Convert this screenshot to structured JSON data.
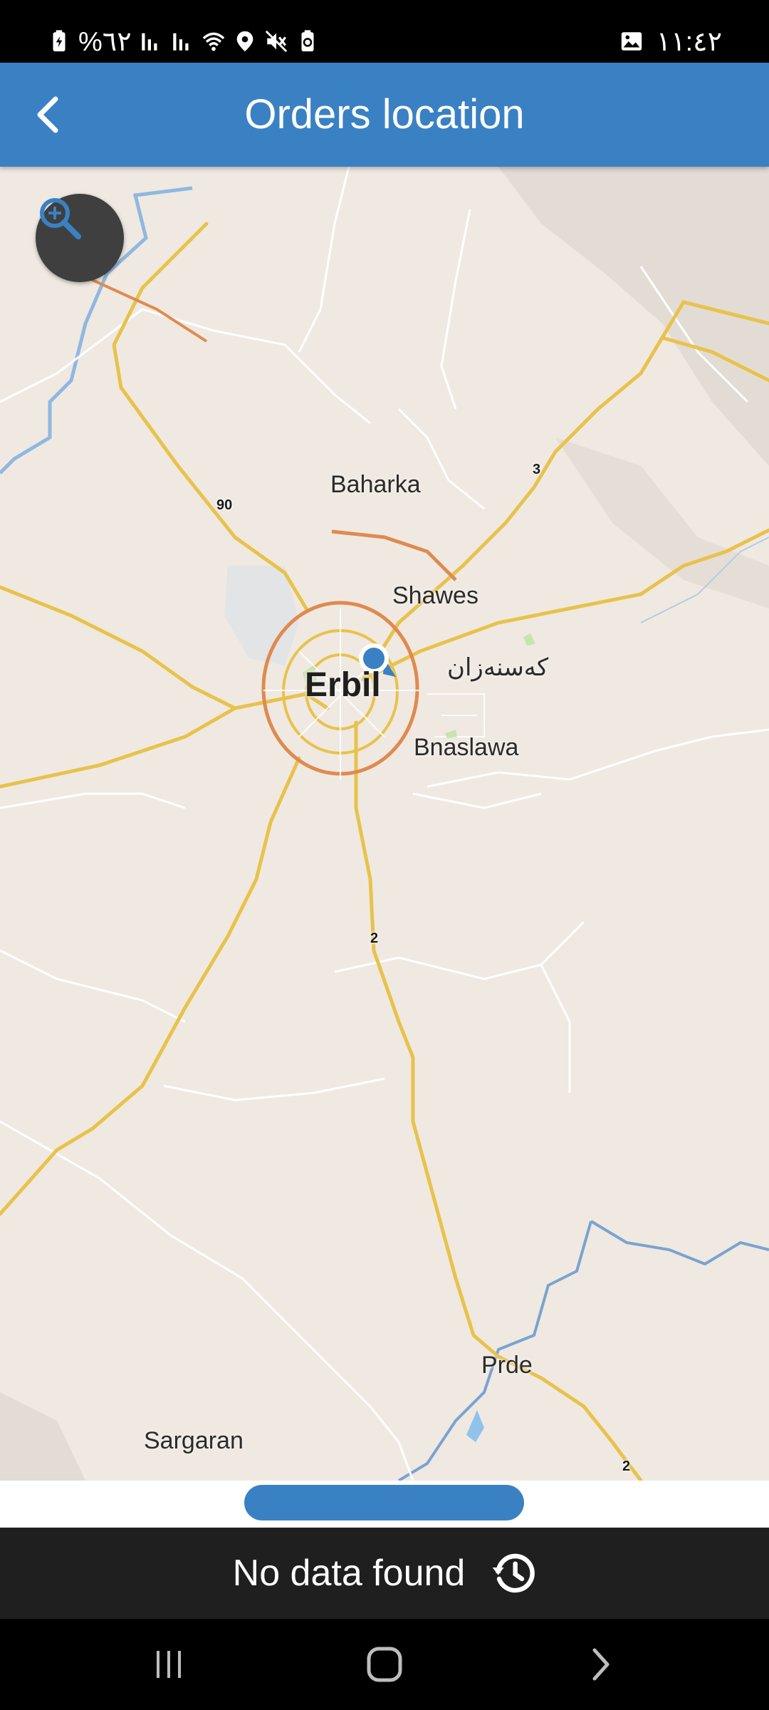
{
  "status_bar": {
    "battery_percent": "%٦٢",
    "time": "١١:٤٢"
  },
  "app_bar": {
    "title": "Orders location"
  },
  "map": {
    "labels": {
      "baharka": "Baharka",
      "shawes": "Shawes",
      "erbil": "Erbil",
      "kasnazan": "کەسنەزان",
      "bnaslawa": "Bnaslawa",
      "prde": "Prde",
      "sargaran": "Sargaran"
    },
    "road_numbers": {
      "r90": "90",
      "r3": "3",
      "r2a": "2",
      "r2b": "2"
    },
    "colors": {
      "land": "#efe9e2",
      "primary_road": "#e8c24a",
      "ring_road": "#e08a4f",
      "water": "#8fb8e0",
      "location_dot": "#3a81c3"
    }
  },
  "bottom": {
    "message": "No data found"
  },
  "icons": {
    "back": "back-arrow-icon",
    "zoom": "zoom-in-icon",
    "history": "history-icon",
    "nav_recents": "recents-icon",
    "nav_home": "home-icon",
    "nav_back": "nav-back-icon"
  }
}
